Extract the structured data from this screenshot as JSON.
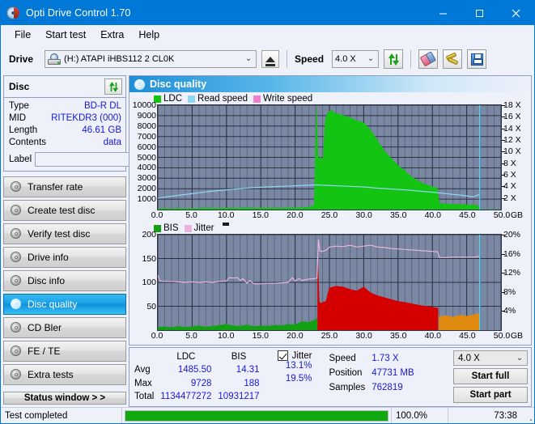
{
  "window": {
    "title": "Opti Drive Control 1.70",
    "icon": "cd-disc-icon",
    "minimize": "minimize-icon",
    "maximize": "maximize-icon",
    "close": "close-icon"
  },
  "menu": {
    "items": [
      "File",
      "Start test",
      "Extra",
      "Help"
    ]
  },
  "toolbar": {
    "drive_label": "Drive",
    "drive_value": "(H:)  ATAPI iHBS112  2 CL0K",
    "eject_icon": "eject-icon",
    "speed_label": "Speed",
    "speed_value": "4.0 X",
    "refresh_icon": "refresh-icon",
    "eraser_icon": "eraser-icon",
    "tools_icon": "tools-icon",
    "save_icon": "save-icon"
  },
  "disc": {
    "title": "Disc",
    "refresh_icon": "refresh-icon",
    "rows": [
      {
        "key": "Type",
        "value": "BD-R DL"
      },
      {
        "key": "MID",
        "value": "RITEKDR3 (000)"
      },
      {
        "key": "Length",
        "value": "46.61 GB"
      },
      {
        "key": "Contents",
        "value": "data"
      }
    ],
    "label_key": "Label",
    "label_value": "",
    "label_placeholder": "",
    "label_button_icon": "cd-disc-icon"
  },
  "nav": {
    "items": [
      {
        "label": "Transfer rate",
        "active": false
      },
      {
        "label": "Create test disc",
        "active": false
      },
      {
        "label": "Verify test disc",
        "active": false
      },
      {
        "label": "Drive info",
        "active": false
      },
      {
        "label": "Disc info",
        "active": false
      },
      {
        "label": "Disc quality",
        "active": true
      },
      {
        "label": "CD Bler",
        "active": false
      },
      {
        "label": "FE / TE",
        "active": false
      },
      {
        "label": "Extra tests",
        "active": false
      }
    ],
    "status_window": "Status window > >"
  },
  "panel": {
    "title": "Disc quality",
    "icon": "cd-disc-icon"
  },
  "stats": {
    "col_headers": [
      "LDC",
      "BIS"
    ],
    "rows": [
      {
        "key": "Avg",
        "ldc": "1485.50",
        "bis": "14.31",
        "jitter": "13.1%"
      },
      {
        "key": "Max",
        "ldc": "9728",
        "bis": "188",
        "jitter": "19.5%"
      },
      {
        "key": "Total",
        "ldc": "1134477272",
        "bis": "10931217",
        "jitter": ""
      }
    ],
    "jitter_label": "Jitter",
    "jitter_checked": true,
    "speed_label": "Speed",
    "speed_value": "1.73 X",
    "position_label": "Position",
    "position_value": "47731 MB",
    "samples_label": "Samples",
    "samples_value": "762819",
    "speed_select": "4.0 X",
    "start_full": "Start full",
    "start_part": "Start part"
  },
  "statusbar": {
    "message": "Test completed",
    "percent_text": "100.0%",
    "percent_value": 100,
    "elapsed": "73:38"
  },
  "colors": {
    "accent": "#0078d7",
    "ldc": "#13c413",
    "read_speed": "#8fd8f5",
    "write_speed": "#f07fd0",
    "bis": "#13a013",
    "jitter": "#e8b4dc",
    "error_red": "#d40000",
    "orange": "#e08a10",
    "plot_bg": "#7b88a4",
    "value_blue": "#1818d6",
    "progress_green": "#10aa10"
  },
  "chart_data": [
    {
      "type": "area",
      "name": "disc-quality-ldc",
      "title": "",
      "xlabel": "GB",
      "ylabel": "LDC",
      "xlim": [
        0,
        50
      ],
      "ylim": [
        0,
        10000
      ],
      "y2lim": [
        0,
        18
      ],
      "y2label": "X",
      "grid": true,
      "legend": [
        "LDC",
        "Read speed",
        "Write speed"
      ],
      "legend_position": "top-left",
      "xticks": [
        "0.0",
        "5.0",
        "10.0",
        "15.0",
        "20.0",
        "25.0",
        "30.0",
        "35.0",
        "40.0",
        "45.0",
        "50.0"
      ],
      "yticks": [
        "1000",
        "2000",
        "3000",
        "4000",
        "5000",
        "6000",
        "7000",
        "8000",
        "9000",
        "10000"
      ],
      "y2ticks": [
        "2 X",
        "4 X",
        "6 X",
        "8 X",
        "10 X",
        "12 X",
        "14 X",
        "16 X",
        "18 X"
      ],
      "series": [
        {
          "name": "LDC",
          "color": "#13c413",
          "x": [
            0.0,
            1.0,
            2.0,
            3.0,
            4.0,
            5.0,
            6.0,
            7.0,
            8.0,
            9.0,
            10.0,
            11.0,
            12.0,
            13.0,
            14.0,
            15.0,
            16.0,
            17.0,
            18.0,
            19.0,
            20.0,
            21.0,
            22.0,
            22.8,
            23.1,
            23.3,
            23.5,
            23.7,
            23.9,
            24.1,
            24.4,
            24.8,
            25.2,
            26.0,
            27.0,
            28.0,
            29.0,
            30.0,
            31.0,
            32.0,
            33.0,
            34.0,
            35.0,
            36.0,
            37.0,
            38.0,
            39.0,
            40.0,
            40.7,
            41.0,
            43.0,
            45.0,
            46.5,
            47.0,
            50.0
          ],
          "values": [
            60,
            90,
            70,
            120,
            80,
            110,
            90,
            140,
            100,
            120,
            150,
            110,
            130,
            160,
            120,
            140,
            130,
            150,
            120,
            160,
            140,
            180,
            220,
            400,
            9800,
            5200,
            4700,
            5100,
            4600,
            5000,
            8600,
            9300,
            9500,
            9200,
            9000,
            8800,
            8500,
            8300,
            7600,
            6600,
            5600,
            4900,
            4200,
            3700,
            3100,
            2700,
            2400,
            2200,
            2050,
            600,
            500,
            450,
            430,
            0,
            0
          ]
        },
        {
          "name": "Read speed",
          "color": "#8fd8f5",
          "unit": "X",
          "x": [
            0.0,
            2.0,
            4.0,
            6.0,
            8.0,
            10.0,
            12.0,
            14.0,
            16.0,
            18.0,
            20.0,
            22.0,
            23.2,
            24.0,
            26.0,
            28.0,
            30.0,
            32.0,
            34.0,
            36.0,
            38.0,
            40.0,
            42.0,
            44.0,
            46.0,
            46.8
          ],
          "values": [
            2.0,
            2.3,
            2.6,
            2.9,
            3.2,
            3.4,
            3.6,
            3.8,
            3.9,
            4.0,
            4.1,
            4.2,
            4.25,
            4.2,
            4.1,
            4.0,
            3.9,
            3.7,
            3.55,
            3.4,
            3.2,
            3.0,
            2.75,
            2.5,
            2.2,
            2.6
          ]
        },
        {
          "name": "Write speed",
          "color": "#f07fd0",
          "x": [],
          "values": []
        }
      ],
      "marker_line": {
        "x": 46.9,
        "color": "#58d2f0"
      }
    },
    {
      "type": "area",
      "name": "disc-quality-bis-jitter",
      "title": "",
      "xlabel": "GB",
      "ylabel": "BIS",
      "xlim": [
        0,
        50
      ],
      "ylim": [
        0,
        200
      ],
      "y2lim": [
        0,
        20
      ],
      "y2label": "%",
      "grid": true,
      "legend": [
        "BIS",
        "Jitter"
      ],
      "legend_position": "top-left",
      "xticks": [
        "0.0",
        "5.0",
        "10.0",
        "15.0",
        "20.0",
        "25.0",
        "30.0",
        "35.0",
        "40.0",
        "45.0",
        "50.0"
      ],
      "yticks": [
        "50",
        "100",
        "150",
        "200"
      ],
      "y2ticks": [
        "4%",
        "8%",
        "12%",
        "16%",
        "20%"
      ],
      "series": [
        {
          "name": "BIS",
          "color": "#13a013",
          "x": [
            0.0,
            1.0,
            2.0,
            3.0,
            4.0,
            5.0,
            6.0,
            7.0,
            8.0,
            9.0,
            10.0,
            11.0,
            12.0,
            13.0,
            14.0,
            15.0,
            16.0,
            17.0,
            18.0,
            19.0,
            20.0,
            21.0,
            22.0,
            23.0,
            23.2
          ],
          "values": [
            6,
            7,
            5,
            8,
            6,
            7,
            9,
            6,
            8,
            10,
            12,
            9,
            8,
            11,
            7,
            9,
            8,
            10,
            9,
            12,
            11,
            18,
            16,
            22,
            24
          ]
        },
        {
          "name": "BIS-high",
          "color": "#d40000",
          "x": [
            23.3,
            23.5,
            23.7,
            24.0,
            24.5,
            25.0,
            26.0,
            27.0,
            28.0,
            29.0,
            30.0,
            31.0,
            32.0,
            33.0,
            34.0,
            35.0,
            36.0,
            37.0,
            38.0,
            39.0,
            40.0,
            40.8
          ],
          "values": [
            142,
            60,
            55,
            58,
            60,
            88,
            92,
            90,
            85,
            82,
            90,
            78,
            72,
            68,
            64,
            60,
            58,
            55,
            52,
            50,
            48,
            46
          ]
        },
        {
          "name": "BIS-orange",
          "color": "#e08a10",
          "x": [
            41.0,
            42.0,
            43.0,
            44.0,
            45.0,
            46.0,
            46.8
          ],
          "values": [
            28,
            30,
            27,
            31,
            29,
            32,
            34
          ]
        },
        {
          "name": "Jitter",
          "color": "#e8b4dc",
          "unit": "%",
          "x": [
            0.0,
            0.3,
            1.0,
            2.0,
            3.0,
            4.0,
            5.0,
            6.0,
            7.0,
            8.0,
            9.0,
            10.0,
            10.4,
            11.0,
            11.6,
            12.0,
            12.4,
            13.0,
            13.4,
            14.0,
            15.0,
            16.0,
            17.0,
            18.0,
            19.0,
            19.6,
            20.0,
            20.6,
            21.0,
            22.0,
            23.0,
            23.2,
            23.4,
            23.6,
            24.0,
            24.6,
            25.0,
            26.0,
            27.0,
            28.0,
            29.0,
            30.0,
            31.0,
            32.0,
            33.0,
            34.0,
            35.0,
            36.0,
            37.0,
            38.0,
            39.0,
            40.0,
            40.8,
            41.0,
            42.0,
            43.0,
            44.0,
            45.0,
            46.0,
            46.8
          ],
          "values": [
            11.5,
            10.3,
            10.2,
            10.2,
            10.1,
            10.0,
            10.1,
            10.0,
            10.1,
            10.0,
            10.2,
            10.3,
            11.0,
            10.9,
            11.0,
            10.4,
            10.8,
            9.8,
            10.4,
            9.7,
            9.7,
            9.8,
            9.8,
            9.9,
            10.0,
            11.0,
            10.3,
            10.8,
            10.4,
            10.7,
            10.8,
            11.0,
            19.0,
            16.6,
            16.5,
            16.8,
            17.4,
            17.6,
            17.5,
            17.8,
            17.4,
            17.6,
            17.8,
            17.4,
            17.3,
            17.1,
            17.0,
            16.9,
            16.8,
            16.7,
            16.6,
            16.5,
            16.4,
            15.2,
            15.2,
            15.3,
            15.3,
            15.3,
            15.3,
            15.4
          ]
        }
      ],
      "marker_line": {
        "x": 46.9,
        "color": "#58d2f0"
      }
    }
  ]
}
